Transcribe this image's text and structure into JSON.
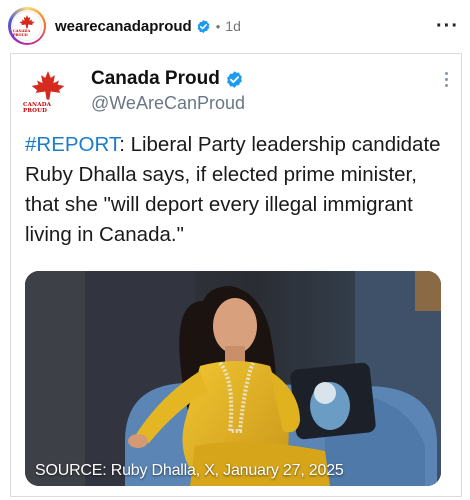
{
  "post": {
    "username": "wearecanadaproud",
    "separator": "•",
    "time": "1d",
    "more_label": "···"
  },
  "tweet": {
    "display_name": "Canada Proud",
    "handle": "@WeAreCanProud",
    "logo_text": "CANADA PROUD",
    "hashtag": "#REPORT",
    "body": ": Liberal Party leadership candidate Ruby Dhalla says, if elected prime minister, that she \"will deport every illegal immigrant living in Canada.\"",
    "media_caption": "SOURCE: Ruby Dhalla, X, January 27, 2025"
  },
  "colors": {
    "hashtag": "#1d7cc9",
    "verified": "#1d9bf0",
    "maple_red": "#d52b1e",
    "dress_yellow": "#e2b21b"
  },
  "icons": {
    "verified": "verified-badge-icon",
    "maple": "maple-leaf-icon",
    "more": "more-dots-icon"
  }
}
